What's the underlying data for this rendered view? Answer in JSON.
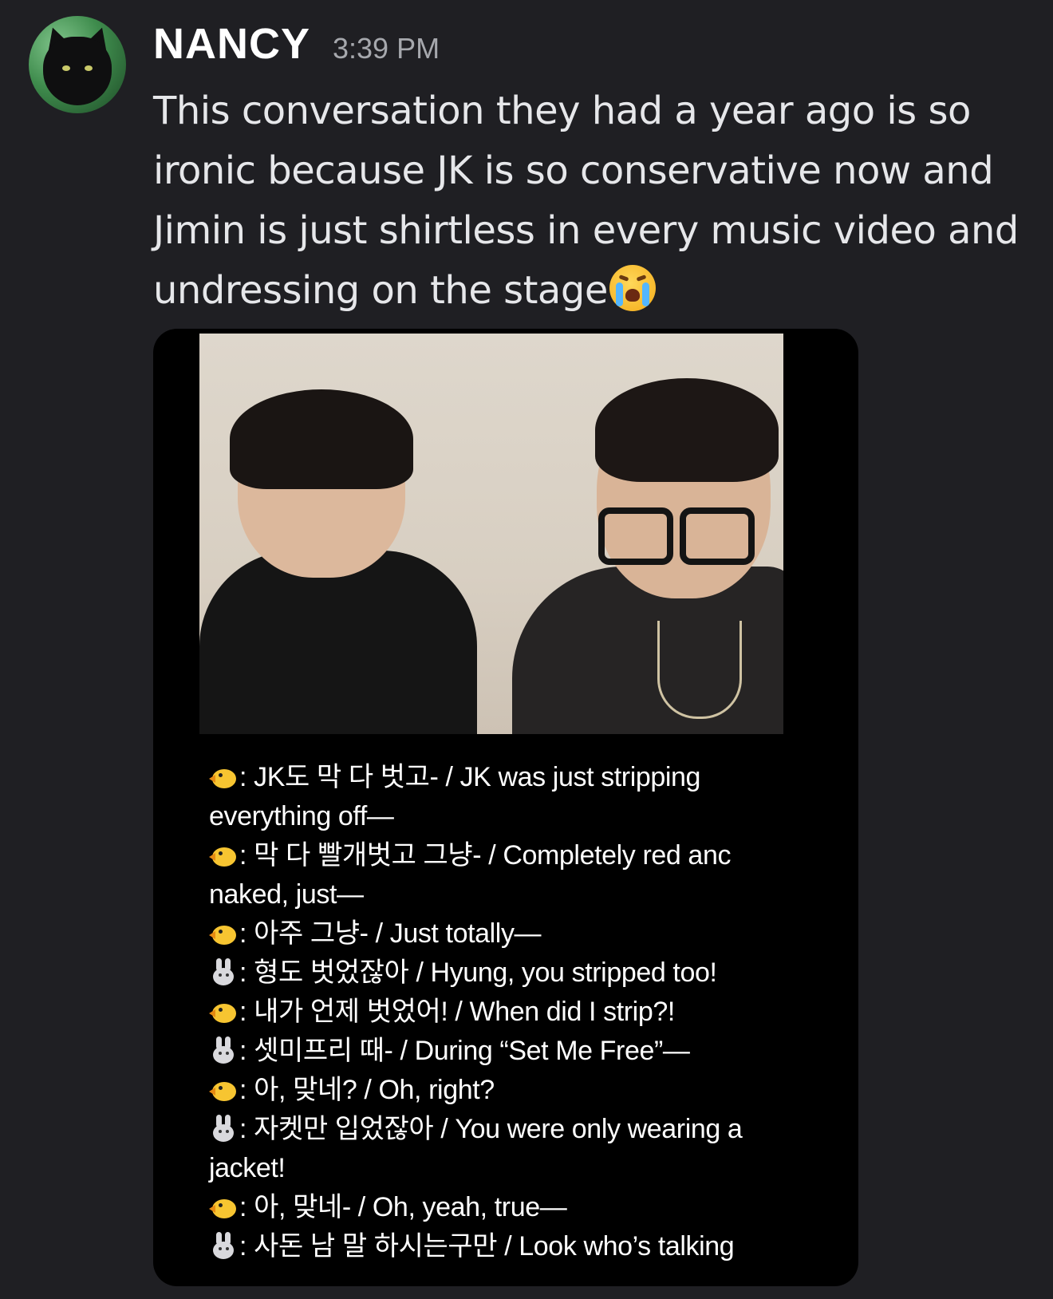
{
  "message": {
    "username": "NANCY",
    "timestamp": "3:39 PM",
    "text": "This conversation they had a year ago is so ironic because JK is so conservative now and Jimin is just shirtless in every music video and undressing on the stage",
    "trailing_emoji": "crying-face-emoji"
  },
  "attachment": {
    "subtitles": [
      {
        "speaker": "chick",
        "text": ": JK도 막 다 벗고- / JK was just stripping everything off—"
      },
      {
        "speaker": "chick",
        "text": ": 막 다 빨개벗고 그냥- / Completely red anc naked, just—"
      },
      {
        "speaker": "chick",
        "text": ": 아주 그냥- / Just totally—"
      },
      {
        "speaker": "bunny",
        "text": ": 형도 벗었잖아 / Hyung, you stripped too!"
      },
      {
        "speaker": "chick",
        "text": ": 내가 언제 벗었어! / When did I strip?!"
      },
      {
        "speaker": "bunny",
        "text": ": 셋미프리 때- / During “Set Me Free”—"
      },
      {
        "speaker": "chick",
        "text": ": 아, 맞네? / Oh, right?"
      },
      {
        "speaker": "bunny",
        "text": ": 자켓만 입었잖아 / You were only wearing a jacket!"
      },
      {
        "speaker": "chick",
        "text": ": 아, 맞네- / Oh, yeah, true—"
      },
      {
        "speaker": "bunny",
        "text": ": 사돈 남 말 하시는구만 / Look who’s talking"
      }
    ]
  }
}
